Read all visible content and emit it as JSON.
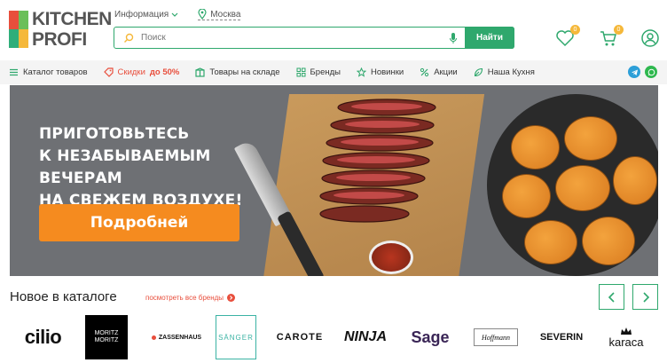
{
  "logo": {
    "line1": "KITCHEN",
    "line2": "PROFI"
  },
  "top_links": {
    "info": "Информация",
    "city": "Москва"
  },
  "search": {
    "placeholder": "Поиск",
    "button": "Найти"
  },
  "header_icons": {
    "favorites_count": "0",
    "cart_count": "0"
  },
  "nav": {
    "items": [
      {
        "label": "Каталог товаров",
        "icon": "menu-icon"
      },
      {
        "label": "Скидки",
        "extra": "до 50%",
        "icon": "tag-icon"
      },
      {
        "label": "Товары на складе",
        "icon": "box-icon"
      },
      {
        "label": "Бренды",
        "icon": "grid-icon"
      },
      {
        "label": "Новинки",
        "icon": "star-icon"
      },
      {
        "label": "Акции",
        "icon": "percent-icon"
      },
      {
        "label": "Наша Кухня",
        "icon": "leaf-icon"
      }
    ]
  },
  "banner": {
    "line1": "Приготовьтесь",
    "line2": "к незабываемым вечерам",
    "line3": "на свежем воздухе!",
    "cta": "Подробней"
  },
  "new_section": {
    "title": "Новое в каталоге",
    "all_brands": "посмотреть все бренды"
  },
  "brands": [
    "cilio",
    "MORITZ MORITZ",
    "ZASSENHAUS",
    "SÄNGER",
    "CAROTE",
    "NINJA",
    "Sage",
    "Hoffmann",
    "SEVERIN",
    "karaca"
  ],
  "colors": {
    "accent": "#2fa86d",
    "sale": "#e84e3c",
    "cta": "#f58b1f",
    "badge": "#f5b83a"
  }
}
